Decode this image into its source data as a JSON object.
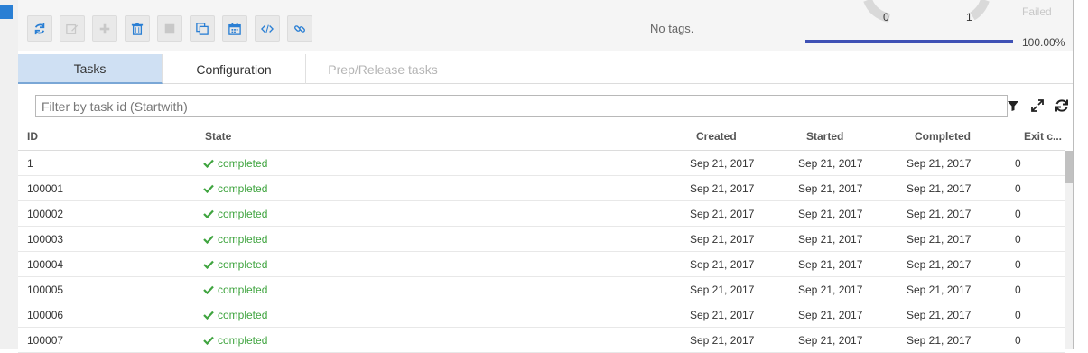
{
  "toolbar": {
    "buttons": [
      {
        "name": "refresh-button",
        "icon": "refresh-icon",
        "enabled": true
      },
      {
        "name": "edit-button",
        "icon": "edit-icon",
        "enabled": false
      },
      {
        "name": "add-button",
        "icon": "plus-icon",
        "enabled": false
      },
      {
        "name": "delete-button",
        "icon": "trash-icon",
        "enabled": true
      },
      {
        "name": "stop-button",
        "icon": "stop-icon",
        "enabled": false
      },
      {
        "name": "clone-button",
        "icon": "copy-icon",
        "enabled": true
      },
      {
        "name": "schedule-button",
        "icon": "calendar-icon",
        "enabled": true
      },
      {
        "name": "code-button",
        "icon": "code-icon",
        "enabled": true
      },
      {
        "name": "link-button",
        "icon": "link-icon",
        "enabled": true
      }
    ],
    "tags_text": "No tags."
  },
  "stats": {
    "left_count": "0",
    "right_count": "1",
    "failed_label": "Failed",
    "progress_percent": "100.00%",
    "progress_value": 1.0,
    "bar_color": "#3f51b5"
  },
  "tabs": [
    {
      "label": "Tasks",
      "state": "active"
    },
    {
      "label": "Configuration",
      "state": "normal"
    },
    {
      "label": "Prep/Release tasks",
      "state": "disabled"
    }
  ],
  "filter": {
    "placeholder": "Filter by task id (Startwith)"
  },
  "table": {
    "columns": [
      "ID",
      "State",
      "Created",
      "Started",
      "Completed",
      "Exit c..."
    ],
    "rows": [
      {
        "id": "1",
        "state": "completed",
        "created": "Sep 21, 2017",
        "started": "Sep 21, 2017",
        "completed": "Sep 21, 2017",
        "exit": "0"
      },
      {
        "id": "100001",
        "state": "completed",
        "created": "Sep 21, 2017",
        "started": "Sep 21, 2017",
        "completed": "Sep 21, 2017",
        "exit": "0"
      },
      {
        "id": "100002",
        "state": "completed",
        "created": "Sep 21, 2017",
        "started": "Sep 21, 2017",
        "completed": "Sep 21, 2017",
        "exit": "0"
      },
      {
        "id": "100003",
        "state": "completed",
        "created": "Sep 21, 2017",
        "started": "Sep 21, 2017",
        "completed": "Sep 21, 2017",
        "exit": "0"
      },
      {
        "id": "100004",
        "state": "completed",
        "created": "Sep 21, 2017",
        "started": "Sep 21, 2017",
        "completed": "Sep 21, 2017",
        "exit": "0"
      },
      {
        "id": "100005",
        "state": "completed",
        "created": "Sep 21, 2017",
        "started": "Sep 21, 2017",
        "completed": "Sep 21, 2017",
        "exit": "0"
      },
      {
        "id": "100006",
        "state": "completed",
        "created": "Sep 21, 2017",
        "started": "Sep 21, 2017",
        "completed": "Sep 21, 2017",
        "exit": "0"
      },
      {
        "id": "100007",
        "state": "completed",
        "created": "Sep 21, 2017",
        "started": "Sep 21, 2017",
        "completed": "Sep 21, 2017",
        "exit": "0"
      }
    ]
  },
  "colors": {
    "accent": "#2a7fd4",
    "success": "#3fa43f",
    "tab_active": "#cfe0f3"
  }
}
